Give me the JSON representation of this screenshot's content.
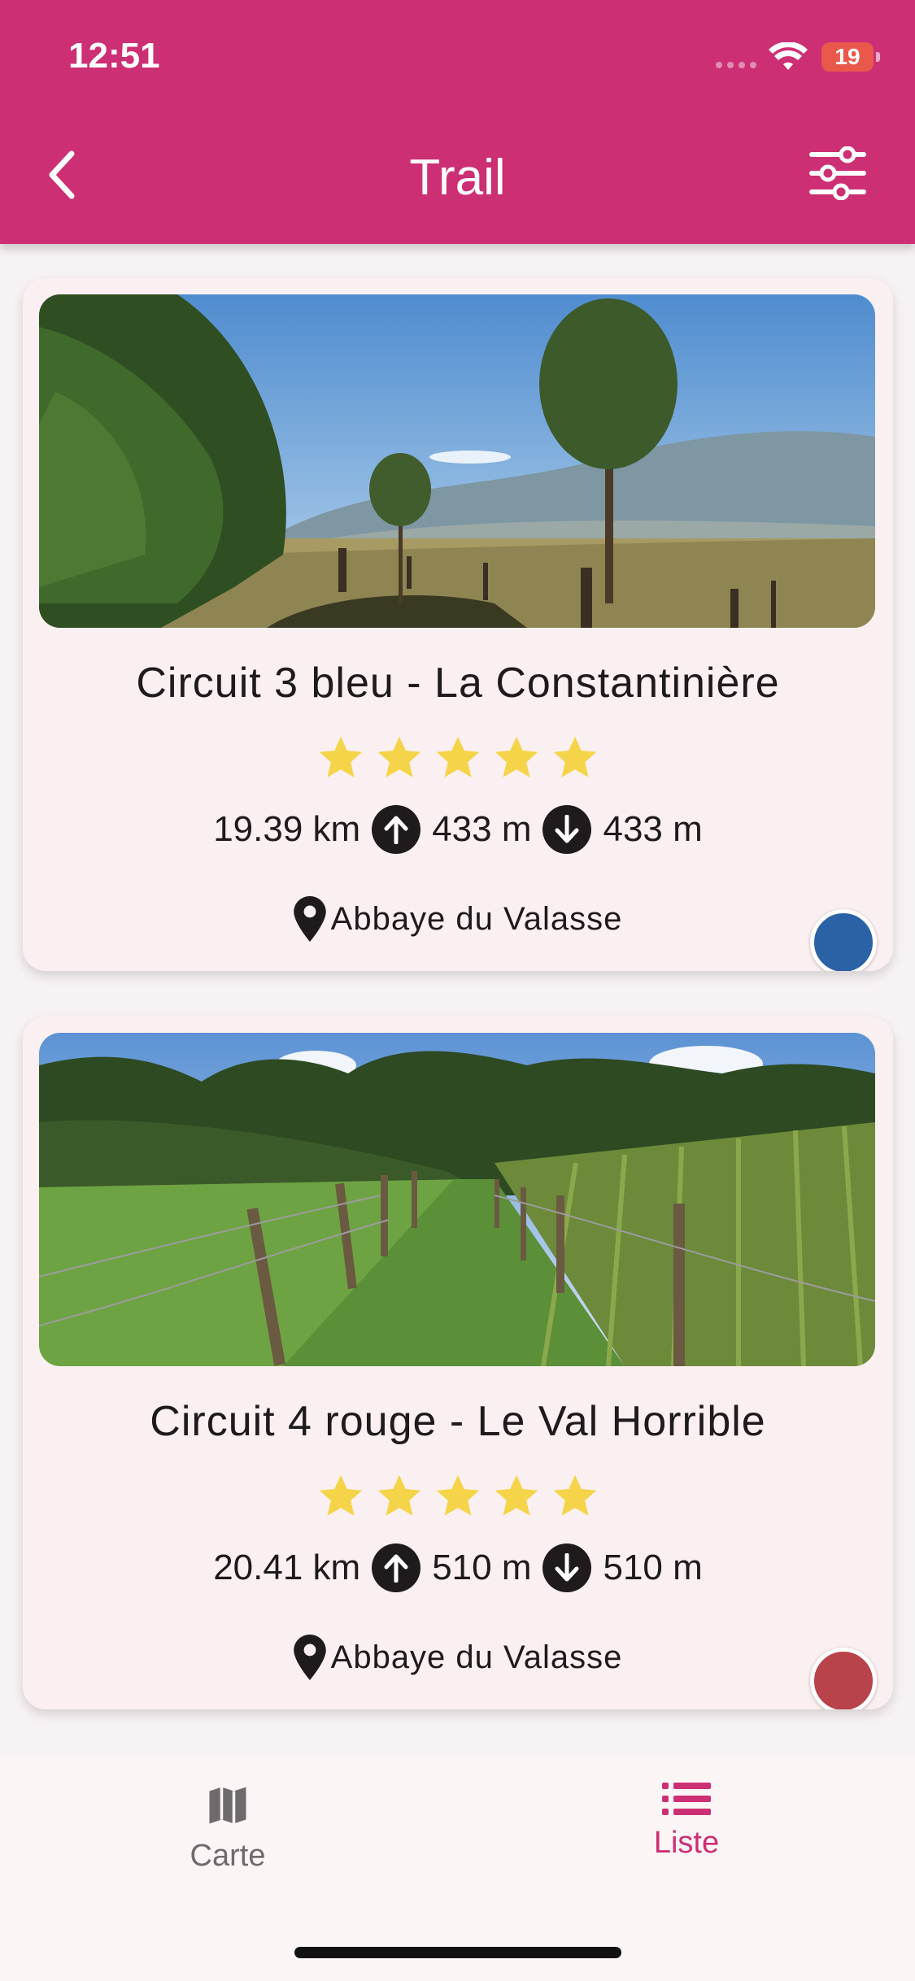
{
  "status_bar": {
    "time": "12:51",
    "battery": "19"
  },
  "header": {
    "title": "Trail"
  },
  "colors": {
    "primary": "#cd2f74",
    "star": "#f5d44a",
    "circuit_blue": "#2b62a6",
    "circuit_red": "#b8434a"
  },
  "trails": [
    {
      "title": "Circuit 3 bleu - La Constantinière",
      "rating": 5,
      "distance": "19.39 km",
      "ascent": "433 m",
      "descent": "433 m",
      "location": "Abbaye du Valasse",
      "color_name": "blue",
      "color": "#2b62a6"
    },
    {
      "title": "Circuit 4 rouge - Le Val Horrible",
      "rating": 5,
      "distance": "20.41 km",
      "ascent": "510 m",
      "descent": "510 m",
      "location": "Abbaye du Valasse",
      "color_name": "red",
      "color": "#b8434a"
    }
  ],
  "bottom_nav": {
    "items": [
      {
        "label": "Carte",
        "icon": "map-icon",
        "active": false
      },
      {
        "label": "Liste",
        "icon": "list-icon",
        "active": true
      }
    ]
  }
}
